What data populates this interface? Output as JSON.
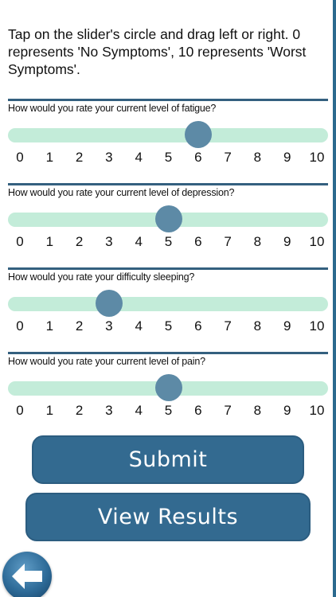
{
  "instructions": "Tap on the slider's circle and drag left or right. 0 represents 'No Symptoms', 10 represents 'Worst Symptoms'.",
  "scale": {
    "min": 0,
    "max": 10,
    "ticks": [
      "0",
      "1",
      "2",
      "3",
      "4",
      "5",
      "6",
      "7",
      "8",
      "9",
      "10"
    ]
  },
  "questions": [
    {
      "label": "How would you rate your current level of fatigue?",
      "value": 6
    },
    {
      "label": "How would you rate your current level of depression?",
      "value": 5
    },
    {
      "label": "How would you rate your difficulty sleeping?",
      "value": 3
    },
    {
      "label": "How would you rate your current level of pain?",
      "value": 5
    }
  ],
  "buttons": {
    "submit": "Submit",
    "view_results": "View Results"
  },
  "colors": {
    "track": "#c3ecd9",
    "thumb": "#5d8aa6",
    "button": "#336a90",
    "divider": "#34607f"
  },
  "icons": {
    "back": "back-arrow-icon"
  }
}
